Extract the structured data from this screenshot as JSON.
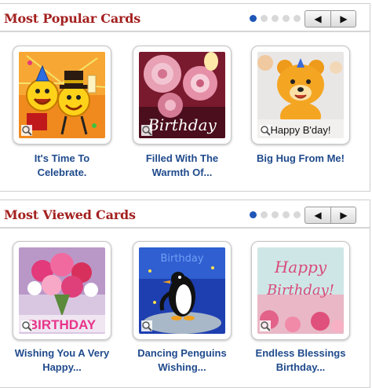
{
  "popular": {
    "title": "Most Popular Cards",
    "page_count": 5,
    "active_page": 1,
    "prev_glyph": "◀",
    "next_glyph": "▶",
    "cards": [
      {
        "caption_line1": "It's Time To",
        "caption_line2": "Celebrate.",
        "thumb_text": ""
      },
      {
        "caption_line1": "Filled With The",
        "caption_line2": "Warmth Of...",
        "thumb_text": "Birthday"
      },
      {
        "caption_line1": "Big Hug From Me!",
        "caption_line2": "",
        "thumb_text": "Happy B'day!"
      }
    ]
  },
  "viewed": {
    "title": "Most Viewed Cards",
    "page_count": 5,
    "active_page": 1,
    "prev_glyph": "◀",
    "next_glyph": "▶",
    "cards": [
      {
        "caption_line1": "Wishing You A Very",
        "caption_line2": "Happy...",
        "thumb_text": "BIRTHDAY"
      },
      {
        "caption_line1": "Dancing Penguins",
        "caption_line2": "Wishing...",
        "thumb_text": "Birthday"
      },
      {
        "caption_line1": "Endless Blessings",
        "caption_line2": "Birthday...",
        "thumb_text_1": "Happy",
        "thumb_text_2": "Birthday!"
      }
    ]
  },
  "colors": {
    "title": "#a3201f",
    "caption": "#1f4a8c",
    "active_dot": "#1f57b8",
    "inactive_dot": "#d8d8d8"
  },
  "icons": [
    "zoom-icon",
    "chevron-left-icon",
    "chevron-right-icon"
  ]
}
